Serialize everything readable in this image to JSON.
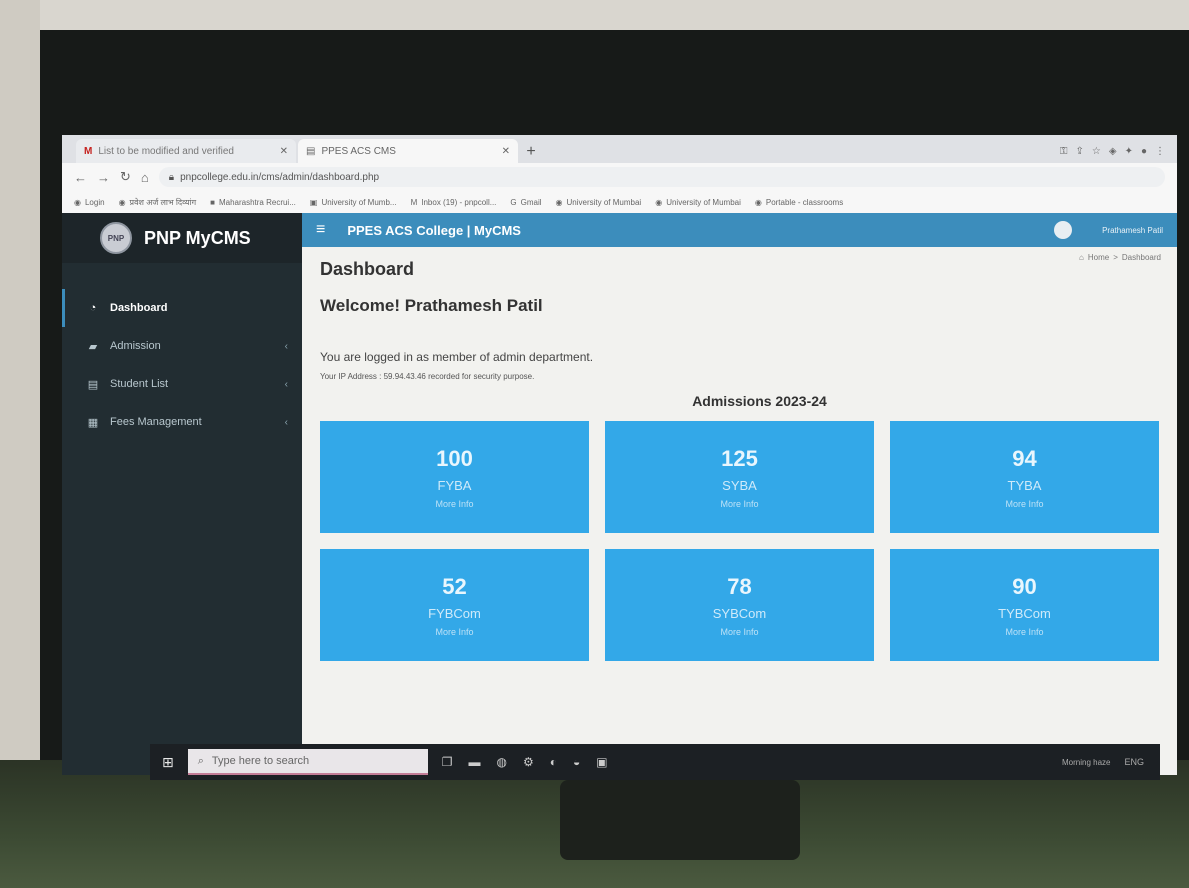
{
  "browser": {
    "tabs": [
      {
        "title": "List to be modified and verified",
        "close": "✕"
      },
      {
        "title": "PPES ACS CMS",
        "close": "✕"
      }
    ],
    "new_tab": "+",
    "url": "pnpcollege.edu.in/cms/admin/dashboard.php",
    "bookmarks": [
      "Login",
      "प्रवेश अर्ज लाभ दिव्यांग",
      "Maharashtra Recrui...",
      "University of Mumb...",
      "Inbox (19) - pnpcoll...",
      "Gmail",
      "University of Mumbai",
      "University of Mumbai",
      "Portable - classrooms"
    ]
  },
  "app": {
    "brand": "PNP MyCMS",
    "brand_logo": "PNP",
    "topbar_title": "PPES ACS College | MyCMS",
    "user_name": "Prathamesh Patil",
    "sidebar": [
      {
        "label": "Dashboard",
        "icon": "dashboard-icon",
        "active": true
      },
      {
        "label": "Admission",
        "icon": "graduation-cap-icon",
        "active": false
      },
      {
        "label": "Student List",
        "icon": "list-icon",
        "active": false
      },
      {
        "label": "Fees Management",
        "icon": "wallet-icon",
        "active": false
      }
    ],
    "breadcrumb": {
      "home": "Home",
      "current": "Dashboard"
    },
    "page_title": "Dashboard",
    "welcome": "Welcome! Prathamesh Patil",
    "logged_in_text": "You are logged in as member of admin department.",
    "ip_text": "Your IP Address : 59.94.43.46 recorded for security purpose.",
    "admissions_title": "Admissions 2023-24",
    "cards": [
      {
        "count": "100",
        "label": "FYBA",
        "more": "More Info"
      },
      {
        "count": "125",
        "label": "SYBA",
        "more": "More Info"
      },
      {
        "count": "94",
        "label": "TYBA",
        "more": "More Info"
      },
      {
        "count": "52",
        "label": "FYBCom",
        "more": "More Info"
      },
      {
        "count": "78",
        "label": "SYBCom",
        "more": "More Info"
      },
      {
        "count": "90",
        "label": "TYBCom",
        "more": "More Info"
      }
    ]
  },
  "taskbar": {
    "search_placeholder": "Type here to search",
    "weather": "Morning haze",
    "tray": "ENG"
  },
  "colors": {
    "accent": "#3c8dbc",
    "card": "#33a8e8",
    "sidebar": "#222d32"
  }
}
